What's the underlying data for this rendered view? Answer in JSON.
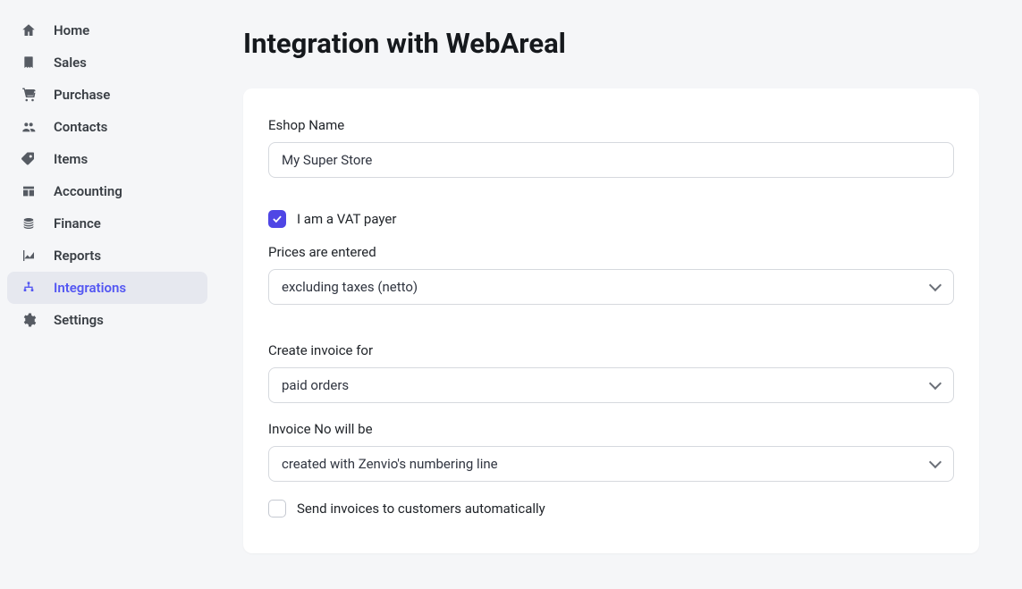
{
  "sidebar": {
    "items": [
      {
        "label": "Home",
        "icon": "home-icon"
      },
      {
        "label": "Sales",
        "icon": "receipt-icon"
      },
      {
        "label": "Purchase",
        "icon": "cart-icon"
      },
      {
        "label": "Contacts",
        "icon": "contacts-icon"
      },
      {
        "label": "Items",
        "icon": "tags-icon"
      },
      {
        "label": "Accounting",
        "icon": "columns-icon"
      },
      {
        "label": "Finance",
        "icon": "coins-icon"
      },
      {
        "label": "Reports",
        "icon": "chart-icon"
      },
      {
        "label": "Integrations",
        "icon": "sitemap-icon",
        "active": true
      },
      {
        "label": "Settings",
        "icon": "gear-icon"
      }
    ]
  },
  "page": {
    "title": "Integration with WebAreal"
  },
  "form": {
    "eshop_name_label": "Eshop Name",
    "eshop_name_value": "My Super Store",
    "vat_payer_checked": true,
    "vat_payer_label": "I am a VAT payer",
    "prices_entered_label": "Prices are entered",
    "prices_entered_value": "excluding taxes (netto)",
    "create_invoice_label": "Create invoice for",
    "create_invoice_value": "paid orders",
    "invoice_no_label": "Invoice No will be",
    "invoice_no_value": "created with Zenvio's numbering line",
    "send_invoices_checked": false,
    "send_invoices_label": "Send invoices to customers automatically"
  }
}
